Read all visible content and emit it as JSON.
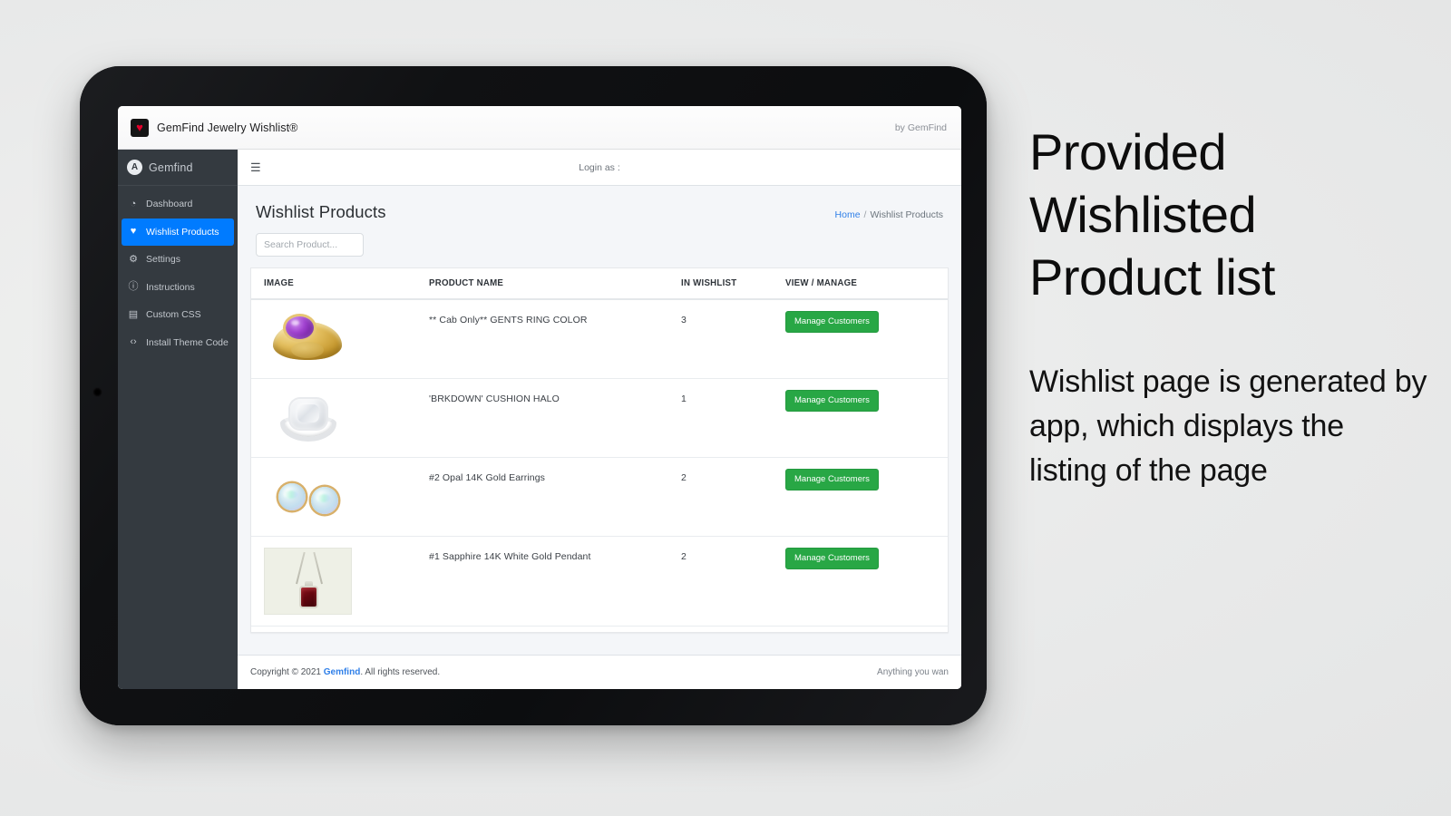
{
  "browser": {
    "favicon_icon": "heart-icon",
    "title": "GemFind Jewelry Wishlist®",
    "by_label": "by GemFind"
  },
  "sidebar": {
    "brand": {
      "mark": "A",
      "name": "Gemfind"
    },
    "items": [
      {
        "icon": "dashboard-icon",
        "glyph": "◔",
        "label": "Dashboard",
        "active": false
      },
      {
        "icon": "heart-icon",
        "glyph": "♥",
        "label": "Wishlist Products",
        "active": true
      },
      {
        "icon": "gear-icon",
        "glyph": "⚙",
        "label": "Settings",
        "active": false
      },
      {
        "icon": "info-icon",
        "glyph": "ⓘ",
        "label": "Instructions",
        "active": false
      },
      {
        "icon": "css-file-icon",
        "glyph": "▤",
        "label": "Custom CSS",
        "active": false
      },
      {
        "icon": "code-icon",
        "glyph": "‹›",
        "label": "Install Theme Code",
        "active": false
      }
    ]
  },
  "topbar": {
    "menu_icon": "hamburger-icon",
    "login_as": "Login as :"
  },
  "page": {
    "title": "Wishlist Products",
    "breadcrumb": {
      "home": "Home",
      "separator": "/",
      "current": "Wishlist Products"
    }
  },
  "search": {
    "placeholder": "Search Product...",
    "value": ""
  },
  "table": {
    "columns": [
      "IMAGE",
      "PRODUCT NAME",
      "IN WISHLIST",
      "VIEW / MANAGE"
    ],
    "rows": [
      {
        "image_alt": "gold-ring-amethyst",
        "name": "** Cab Only** GENTS RING COLOR",
        "in_wishlist": "3",
        "action_label": "Manage Customers"
      },
      {
        "image_alt": "white-gold-cushion-halo-ring",
        "name": "'BRKDOWN' CUSHION HALO",
        "in_wishlist": "1",
        "action_label": "Manage Customers"
      },
      {
        "image_alt": "opal-stud-earrings",
        "name": "#2 Opal 14K Gold Earrings",
        "in_wishlist": "2",
        "action_label": "Manage Customers"
      },
      {
        "image_alt": "garnet-pendant-necklace",
        "name": "#1 Sapphire 14K White Gold Pendant",
        "in_wishlist": "2",
        "action_label": "Manage Customers"
      }
    ]
  },
  "footer": {
    "copyright_prefix": "Copyright © 2021 ",
    "brand": "Gemfind",
    "copyright_suffix": ". All rights reserved.",
    "right_text": "Anything you wan"
  },
  "callout": {
    "heading": "Provided Wishlisted Product list",
    "body": "Wishlist page is generated by app, which displays the listing of the page"
  },
  "colors": {
    "sidebar_bg": "#343a40",
    "active_nav": "#007bff",
    "accent_link": "#2f7fe8",
    "button_green": "#28a745",
    "page_bg": "#f4f6f9"
  }
}
